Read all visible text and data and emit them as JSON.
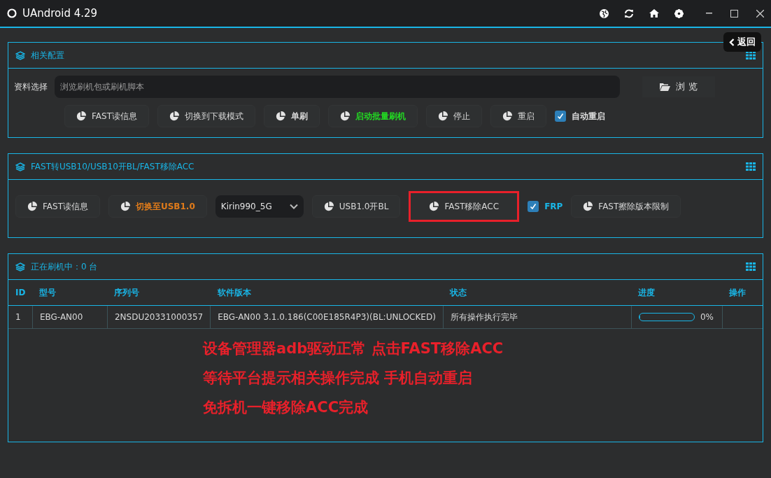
{
  "window": {
    "title": "UAndroid 4.29"
  },
  "back_button": {
    "label": "返回"
  },
  "config_panel": {
    "title": "相关配置",
    "file_label": "资料选择",
    "file_field": {
      "placeholder": "浏览刷机包或刷机脚本"
    },
    "browse_button": {
      "label": "浏 览"
    },
    "actions": [
      {
        "kind": "button",
        "label": "FAST读信息",
        "color": "#d8d8d8",
        "bold": false,
        "highlighted": false
      },
      {
        "kind": "button",
        "label": "切换到下载模式",
        "color": "#d8d8d8",
        "bold": false,
        "highlighted": false
      },
      {
        "kind": "button",
        "label": "单刷",
        "color": "#d8d8d8",
        "bold": true,
        "highlighted": false
      },
      {
        "kind": "button",
        "label": "启动批量刷机",
        "color": "#22dd22",
        "bold": true,
        "highlighted": false
      },
      {
        "kind": "button",
        "label": "停止",
        "color": "#d8d8d8",
        "bold": false,
        "highlighted": false
      },
      {
        "kind": "button",
        "label": "重启",
        "color": "#d8d8d8",
        "bold": false,
        "highlighted": false
      },
      {
        "kind": "checkbox",
        "label": "自动重启",
        "checked": true
      }
    ]
  },
  "fast_panel": {
    "title": "FAST转USB10/USB10开BL/FAST移除ACC",
    "actions": [
      {
        "kind": "button",
        "label": "FAST读信息",
        "color": "#d8d8d8",
        "bold": false,
        "highlighted": false
      },
      {
        "kind": "button",
        "label": "切换至USB1.0",
        "color": "#e07b1a",
        "bold": true,
        "highlighted": false
      },
      {
        "kind": "dropdown",
        "value": "Kirin990_5G"
      },
      {
        "kind": "button",
        "label": "USB1.0开BL",
        "color": "#d8d8d8",
        "bold": false,
        "highlighted": false
      },
      {
        "kind": "button",
        "label": "FAST移除ACC",
        "color": "#d8d8d8",
        "bold": false,
        "highlighted": true
      },
      {
        "kind": "checkbox",
        "label": "FRP",
        "checked": true
      },
      {
        "kind": "button",
        "label": "FAST擦除版本限制",
        "color": "#d8d8d8",
        "bold": false,
        "highlighted": false
      }
    ]
  },
  "flashing_panel": {
    "title": "正在刷机中：0 台",
    "table": {
      "columns": [
        "ID",
        "型号",
        "序列号",
        "软件版本",
        "状态",
        "进度",
        "操作"
      ],
      "rows": [
        {
          "id": "1",
          "model": "EBG-AN00",
          "serial": "2NSDU20331000357",
          "version": "EBG-AN00 3.1.0.186(C00E185R4P3)(BL:UNLOCKED)",
          "status": "所有操作执行完毕",
          "level": 0,
          "reading": "0%"
        }
      ]
    },
    "annotation": [
      "设备管理器adb驱动正常 点击FAST移除ACC",
      "等待平台提示相关操作完成 手机自动重启",
      "免拆机一键移除ACC完成"
    ]
  }
}
